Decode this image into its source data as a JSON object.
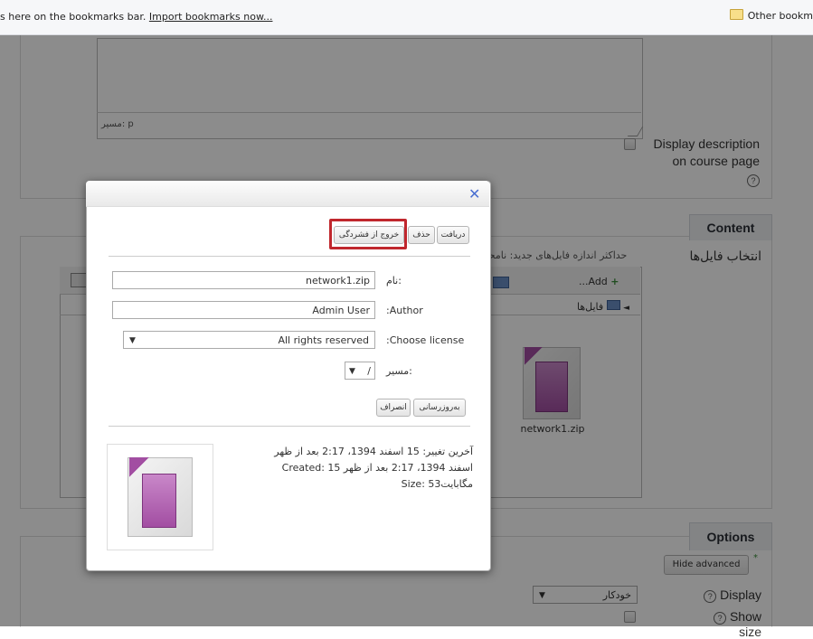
{
  "bookmarks_bar": {
    "message": "s here on the bookmarks bar.",
    "import_link": "Import bookmarks now...",
    "other_bookmarks": "Other bookm"
  },
  "editor": {
    "path_label": "مسیر: p"
  },
  "display_description": {
    "label_line1": "Display description",
    "label_line2": "on course page"
  },
  "content_section": {
    "header": "Content",
    "select_files_label": "انتخاب فایل‌ها",
    "max_size_text": "حداکثر اندازه فایل‌های جدید: نامحد",
    "add_label": "...Add",
    "files_breadcrumb": "فایل‌ها",
    "file_name": "network1.zip"
  },
  "options_section": {
    "header": "Options",
    "hide_advanced": "Hide advanced",
    "display_label": "Display",
    "display_value": "خودکار",
    "show_size_label": "Show size"
  },
  "dialog": {
    "buttons": {
      "download": "دریافت",
      "delete": "حذف",
      "unzip": "خروج از فشردگی"
    },
    "name_label": "نام:",
    "name_value": "network1.zip",
    "author_label": ":Author",
    "author_value": "Admin User",
    "license_label": ":Choose license",
    "license_value": "All rights reserved",
    "path_label": "مسیر:",
    "path_value": "/",
    "update_button": "به‌روزرسانی",
    "cancel_button": "انصراف",
    "modified": "آخرین تغییر: 15 اسفند 1394، 2:17 بعد از ظهر",
    "created": "Created: 15 اسفند 1394، 2:17 بعد از ظهر",
    "size": "Size: 53مگابایت"
  },
  "colors": {
    "highlight": "#c0272d",
    "close_x": "#4a6fd1",
    "zip_icon_accent": "#a24ea2"
  }
}
